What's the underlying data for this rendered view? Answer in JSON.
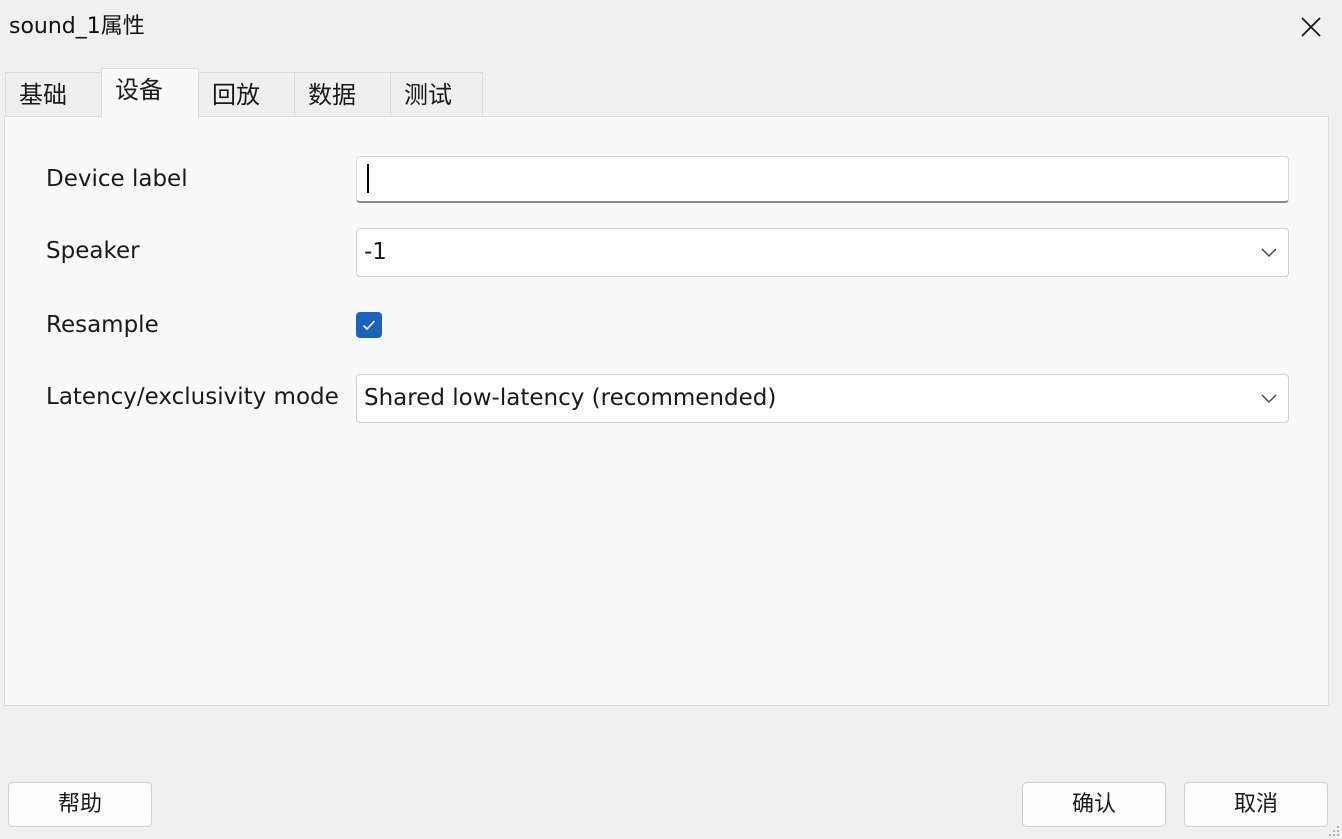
{
  "window": {
    "title": "sound_1属性"
  },
  "tabs": [
    {
      "label": "基础",
      "active": false
    },
    {
      "label": "设备",
      "active": true
    },
    {
      "label": "回放",
      "active": false
    },
    {
      "label": "数据",
      "active": false
    },
    {
      "label": "测试",
      "active": false
    }
  ],
  "form": {
    "device_label": {
      "label": "Device label",
      "value": ""
    },
    "speaker": {
      "label": "Speaker",
      "value": "-1"
    },
    "resample": {
      "label": "Resample",
      "checked": true
    },
    "latency_mode": {
      "label": "Latency/exclusivity mode",
      "value": "Shared low-latency (recommended)"
    }
  },
  "buttons": {
    "help": "帮助",
    "ok": "确认",
    "cancel": "取消"
  },
  "colors": {
    "accent": "#1b62c0",
    "window_bg": "#f0f0f0",
    "panel_bg": "#f9f9f9"
  },
  "icons": {
    "close": "close-icon",
    "dropdown": "chevron-down-icon",
    "check": "checkmark-icon",
    "resize": "resize-grip-icon"
  }
}
